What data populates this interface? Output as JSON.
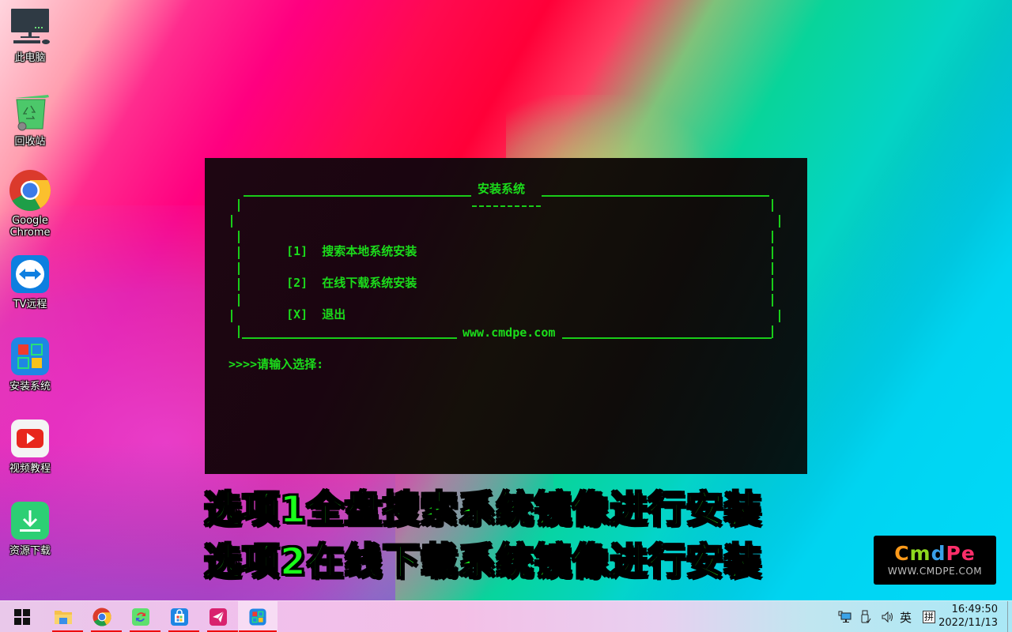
{
  "desktop": {
    "icons": [
      {
        "id": "this-pc",
        "label": "此电脑",
        "icon": "computer-monitor-icon"
      },
      {
        "id": "recycle-bin",
        "label": "回收站",
        "icon": "recycle-bin-icon"
      },
      {
        "id": "google-chrome",
        "label": "Google\nChrome",
        "icon": "chrome-icon"
      },
      {
        "id": "tv-remote",
        "label": "TV远程",
        "icon": "teamviewer-icon"
      },
      {
        "id": "install-system",
        "label": "安装系统",
        "icon": "install-system-icon"
      },
      {
        "id": "video-tutorial",
        "label": "视频教程",
        "icon": "video-play-icon"
      },
      {
        "id": "resource-download",
        "label": "资源下载",
        "icon": "download-icon"
      }
    ]
  },
  "console": {
    "title": "安装系统",
    "title_underline": "----------",
    "options": [
      {
        "key": "[1]",
        "label": "搜索本地系统安装"
      },
      {
        "key": "[2]",
        "label": "在线下载系统安装"
      },
      {
        "key": "[X]",
        "label": "退出"
      }
    ],
    "footer": "www.cmdpe.com",
    "prompt": ">>>>请输入选择:",
    "text_color": "#1bdc1b"
  },
  "caption": {
    "line1": "选项1全盘搜索系统镜像进行安装",
    "line2": "选项2在线下载系统镜像进行安装",
    "color": "#1aff1a"
  },
  "watermark": {
    "logo_letters": [
      {
        "ch": "C",
        "color": "#ff9a1a"
      },
      {
        "ch": "m",
        "color": "#8ed81e"
      },
      {
        "ch": "d",
        "color": "#3aa0e8"
      },
      {
        "ch": "P",
        "color": "#ff2e6a"
      },
      {
        "ch": "e",
        "color": "#ff2e6a"
      }
    ],
    "url": "WWW.CMDPE.COM"
  },
  "taskbar": {
    "start": "start-icon",
    "apps": [
      {
        "name": "file-explorer",
        "icon": "folder-icon",
        "active": false
      },
      {
        "name": "chrome",
        "icon": "chrome-icon",
        "active": false
      },
      {
        "name": "sync-tool",
        "icon": "sync-icon",
        "active": false
      },
      {
        "name": "store",
        "icon": "store-icon",
        "active": false
      },
      {
        "name": "paper-plane-app",
        "icon": "paper-plane-icon",
        "active": false
      },
      {
        "name": "install-system",
        "icon": "install-system-icon",
        "active": true
      }
    ],
    "tray": {
      "network": "network-icon",
      "usb": "usb-icon",
      "volume": "volume-icon",
      "ime_lang": "英",
      "ime_mode": "拼"
    },
    "time": "16:49:50",
    "date": "2022/11/13"
  }
}
